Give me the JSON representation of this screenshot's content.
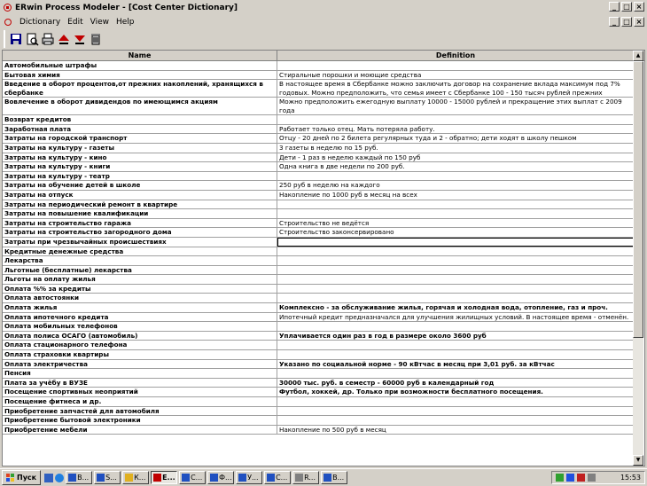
{
  "window": {
    "title": "ERwin Process Modeler - [Cost Center Dictionary]",
    "controls": {
      "minimize": "_",
      "maximize": "□",
      "close": "×"
    }
  },
  "menu": {
    "items": [
      "Dictionary",
      "Edit",
      "View",
      "Help"
    ],
    "mdi_controls": {
      "minimize": "_",
      "restore": "□",
      "close": "×"
    }
  },
  "toolbar": {
    "buttons": [
      "save-icon",
      "print-preview-icon",
      "print-icon",
      "move-up-icon",
      "move-down-icon",
      "delete-icon"
    ]
  },
  "grid": {
    "headers": {
      "name": "Name",
      "definition": "Definition"
    },
    "rows": [
      {
        "name": "Автомобильные штрафы",
        "def": ""
      },
      {
        "name": "Бытовая химия",
        "def": "Стиральные порошки и моющие средства"
      },
      {
        "name": "Введение в оборот процентов,от прежних накоплений, хранящихся в сбербанке",
        "def": "В настоящее время в Сбербанке можно заключить договор на сохранение вклада максимум под 7% годовых. Можно предположить, что семья имеет с Сбербанке 100 - 150 тысяч рублей прежних накоплений"
      },
      {
        "name": "Вовлечение в оборот дивидендов по имеющимся акциям",
        "def": "Можно предположить ежегодную выплату 10000 - 15000 рублей и прекращение этих выплат с 2009 года"
      },
      {
        "name": "Возврат кредитов",
        "def": ""
      },
      {
        "name": "Заработная плата",
        "def": "Работает только отец. Мать потеряла работу."
      },
      {
        "name": "Затраты на городской транспорт",
        "def": "Отцу - 20 дней по 2 билета регулярных туда и 2 - обратно; дети ходят в школу пешком"
      },
      {
        "name": "Затраты на культуру - газеты",
        "def": "3 газеты в неделю по 15 руб."
      },
      {
        "name": "Затраты на культуру - кино",
        "def": "Дети - 1 раз в неделю  каждый по 150 руб"
      },
      {
        "name": "Затраты на культуру - книги",
        "def": "Одна книга в две недели по 200 руб."
      },
      {
        "name": "Затраты на культуру - театр",
        "def": ""
      },
      {
        "name": "Затраты на обучение детей в школе",
        "def": "250 руб в неделю на каждого"
      },
      {
        "name": "Затраты на отпуск",
        "def": "Накопление по 1000 руб в месяц на всех"
      },
      {
        "name": "Затраты на периодический ремонт в квартире",
        "def": ""
      },
      {
        "name": "Затраты на повышение квалификации",
        "def": ""
      },
      {
        "name": "Затраты на строительство гаража",
        "def": "Строительство не ведётся"
      },
      {
        "name": "Затраты на строительство загородного дома",
        "def": "Строительство законсервировано"
      },
      {
        "name": "Затраты при чрезвычайных происшествиях",
        "def": ""
      },
      {
        "name": "Кредитные денежные средства",
        "def": ""
      },
      {
        "name": "Лекарства",
        "def": ""
      },
      {
        "name": "Льготные (бесплатные) лекарства",
        "def": ""
      },
      {
        "name": "Льготы на оплату жилья",
        "def": ""
      },
      {
        "name": "Оплата %% за кредиты",
        "def": ""
      },
      {
        "name": "Оплата автостоянки",
        "def": ""
      },
      {
        "name": "Оплата жилья",
        "def": "Комплексно - за обслуживание жилья, горячая и холодная вода, отопление, газ и проч."
      },
      {
        "name": "Оплата ипотечного кредита",
        "def": "Ипотечный кредит предназначался для улучшения жилищных условий. В настоящее время - отменён."
      },
      {
        "name": "Оплата мобильных телефонов",
        "def": ""
      },
      {
        "name": "Оплата полиса ОСАГО (автомобиль)",
        "def": "Уплачивается один раз в год в размере около 3600 руб"
      },
      {
        "name": "Оплата стационарного телефона",
        "def": ""
      },
      {
        "name": "Оплата страховки квартиры",
        "def": ""
      },
      {
        "name": "Оплата электричества",
        "def": "Указано по социальной норме - 90 кВтчас в месяц при 3,01 руб. за кВтчас"
      },
      {
        "name": "Пенсия",
        "def": ""
      },
      {
        "name": "Плата за учёбу в ВУЗЕ",
        "def": "30000 тыс. руб. в семестр - 60000 руб в календарный год"
      },
      {
        "name": "Посещение спортивных неоприятий",
        "def": "Футбол, хоккей, др. Только при возможности бесплатного посещения."
      },
      {
        "name": "Посещение фитнеса и др.",
        "def": ""
      },
      {
        "name": "Приобретение запчастей для автомобиля",
        "def": ""
      },
      {
        "name": "Приобретение бытовой электроники",
        "def": ""
      },
      {
        "name": "Приобретение мебели",
        "def": "Накопление по 500 руб в месяц"
      }
    ]
  },
  "taskbar": {
    "start_label": "Пуск",
    "tasks": [
      "В...",
      "S...",
      "К...",
      "E...",
      "С...",
      "Ф...",
      "У...",
      "С...",
      "R...",
      "В..."
    ],
    "clock": "15:53"
  }
}
